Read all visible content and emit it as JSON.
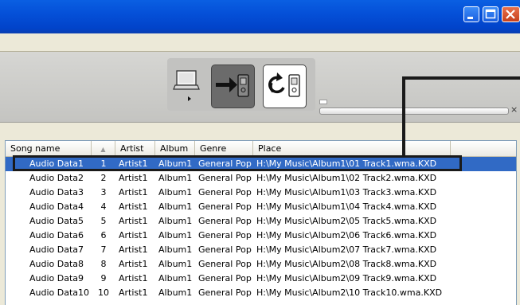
{
  "window": {
    "controls": [
      "minimize-icon",
      "maximize-icon",
      "close-icon"
    ]
  },
  "toolbar": {
    "buttons": [
      {
        "icon": "computer-icon"
      },
      {
        "icon": "transfer-to-device-icon"
      },
      {
        "icon": "sync-device-icon"
      }
    ],
    "progress_close": "×"
  },
  "list": {
    "columns": [
      "Song name",
      "",
      "Artist",
      "Album",
      "Genre",
      "Place"
    ],
    "sort_indicator": "▲",
    "rows": [
      {
        "name": "Audio Data1",
        "num": "1",
        "artist": "Artist1",
        "album": "Album1",
        "genre": "General Pop",
        "place": "H:\\My Music\\Album1\\01 Track1.wma.KXD"
      },
      {
        "name": "Audio Data2",
        "num": "2",
        "artist": "Artist1",
        "album": "Album1",
        "genre": "General Pop",
        "place": "H:\\My Music\\Album1\\02 Track2.wma.KXD"
      },
      {
        "name": "Audio Data3",
        "num": "3",
        "artist": "Artist1",
        "album": "Album1",
        "genre": "General Pop",
        "place": "H:\\My Music\\Album1\\03 Track3.wma.KXD"
      },
      {
        "name": "Audio Data4",
        "num": "4",
        "artist": "Artist1",
        "album": "Album1",
        "genre": "General Pop",
        "place": "H:\\My Music\\Album1\\04 Track4.wma.KXD"
      },
      {
        "name": "Audio Data5",
        "num": "5",
        "artist": "Artist1",
        "album": "Album1",
        "genre": "General Pop",
        "place": "H:\\My Music\\Album2\\05 Track5.wma.KXD"
      },
      {
        "name": "Audio Data6",
        "num": "6",
        "artist": "Artist1",
        "album": "Album1",
        "genre": "General Pop",
        "place": "H:\\My Music\\Album2\\06 Track6.wma.KXD"
      },
      {
        "name": "Audio Data7",
        "num": "7",
        "artist": "Artist1",
        "album": "Album1",
        "genre": "General Pop",
        "place": "H:\\My Music\\Album2\\07 Track7.wma.KXD"
      },
      {
        "name": "Audio Data8",
        "num": "8",
        "artist": "Artist1",
        "album": "Album1",
        "genre": "General Pop",
        "place": "H:\\My Music\\Album2\\08 Track8.wma.KXD"
      },
      {
        "name": "Audio Data9",
        "num": "9",
        "artist": "Artist1",
        "album": "Album1",
        "genre": "General Pop",
        "place": "H:\\My Music\\Album2\\09 Track9.wma.KXD"
      },
      {
        "name": "Audio Data10",
        "num": "10",
        "artist": "Artist1",
        "album": "Album1",
        "genre": "General Pop",
        "place": "H:\\My Music\\Album2\\10 Track10.wma.KXD"
      }
    ],
    "selected_row": 0
  },
  "colors": {
    "selection": "#316ac5",
    "titlebar": "#0550d8",
    "callout": "#1a1a1a"
  }
}
